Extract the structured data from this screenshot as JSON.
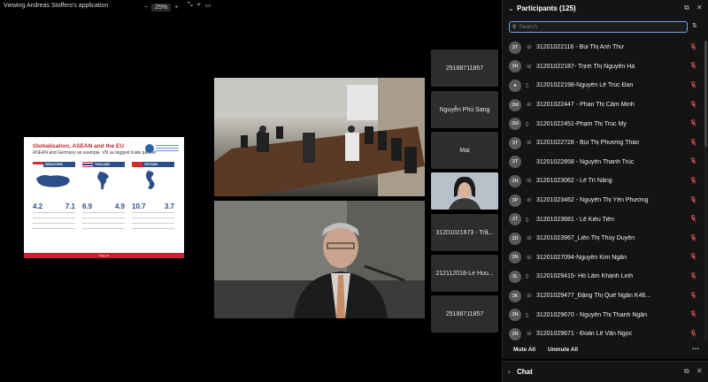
{
  "topbar": {
    "title": "Viewing Andreas Stoffers's application",
    "zoom_out": "−",
    "zoom_value": "25%",
    "zoom_in": "+"
  },
  "slide": {
    "title": "Globalisation, ASEAN and the EU",
    "subtitle": "ASEAN and Germany as example, VN as biggest trade partner",
    "footer": "Page 10",
    "columns": [
      {
        "country": "SINGAPORE",
        "left_big": "4.2",
        "right_big": "7.1"
      },
      {
        "country": "THAILAND",
        "left_big": "6.9",
        "right_big": "4.9"
      },
      {
        "country": "VIETNAM",
        "left_big": "10.7",
        "right_big": "3.7"
      }
    ]
  },
  "tiles": [
    {
      "label": "25188711857"
    },
    {
      "label": "Nguyễn Phú Sang"
    },
    {
      "label": "Mai"
    },
    {
      "label": ""
    },
    {
      "label": "31201021673 - Trầ..."
    },
    {
      "label": "212112018-Le Huu..."
    },
    {
      "label": "25188711857"
    }
  ],
  "participants": {
    "header": "Participants (125)",
    "search_placeholder": "Search",
    "list": [
      {
        "initials": "3T",
        "device": "phone",
        "name": "31201022116 - Bùi Thị Anh Thư"
      },
      {
        "initials": "3H",
        "device": "phone",
        "name": "31201022187- Trịnh Thị Nguyên Hà"
      },
      {
        "initials": "",
        "device": "mobile",
        "name": "31201022198-Nguyễn Lê Trúc Đan"
      },
      {
        "initials": "3M",
        "device": "phone",
        "name": "31201022447 - Phan Thị Cẩm Minh"
      },
      {
        "initials": "3M",
        "device": "mobile",
        "name": "31201022451-Phạm Thị Trúc My"
      },
      {
        "initials": "3T",
        "device": "phone",
        "name": "31201022728 - Bùi Thị Phương Thảo"
      },
      {
        "initials": "3T",
        "device": "",
        "name": "31201022858 - Nguyễn Thanh Trúc"
      },
      {
        "initials": "3N",
        "device": "phone",
        "name": "31201023062 - Lê Trí Năng"
      },
      {
        "initials": "3P",
        "device": "phone",
        "name": "31201023462 - Nguyễn Thị Yến Phương"
      },
      {
        "initials": "3T",
        "device": "mobile",
        "name": "31201023681 - Lê Kiều Tiên"
      },
      {
        "initials": "3D",
        "device": "phone",
        "name": "31201023967_Liên Thị Thùy Duyên"
      },
      {
        "initials": "3N",
        "device": "phone",
        "name": "31201027094-Nguyễn Kim Ngân"
      },
      {
        "initials": "3L",
        "device": "mobile",
        "name": "31201029415- Hồ Lâm Khánh Linh"
      },
      {
        "initials": "3K",
        "device": "phone",
        "name": "31201029477_Đặng Thị Quế Ngân K46..."
      },
      {
        "initials": "3N",
        "device": "mobile",
        "name": "31201029670 - Nguyễn Thị Thanh Ngân"
      },
      {
        "initials": "3N",
        "device": "phone",
        "name": "31201029671 - Đoàn Lê Văn Ngọc"
      }
    ],
    "mute_all": "Mute All",
    "unmute_all": "Unmute All"
  },
  "chat": {
    "header": "Chat"
  }
}
